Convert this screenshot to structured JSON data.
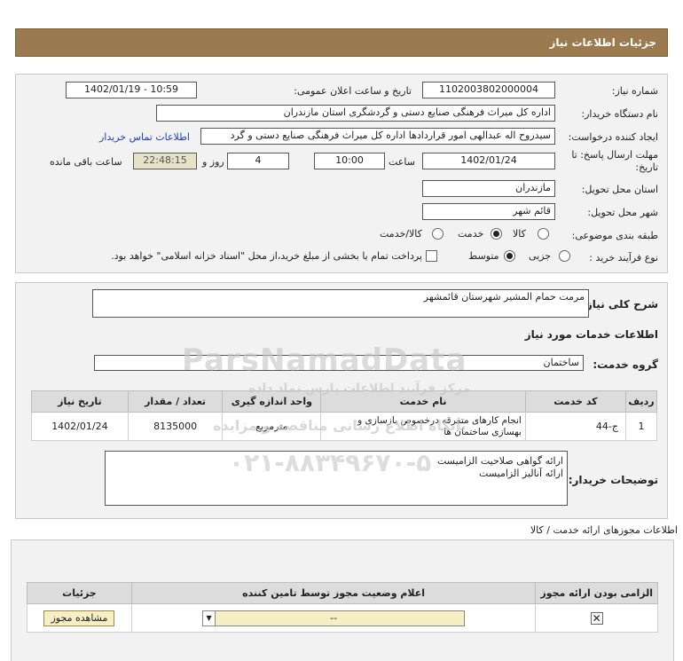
{
  "header": {
    "title": "جزئیات اطلاعات نیاز"
  },
  "labels": {
    "need_number": "شماره نیاز:",
    "announce_datetime": "تاریخ و ساعت اعلان عمومی:",
    "buyer_org": "نام دستگاه خریدار:",
    "requester": "ایجاد کننده درخواست:",
    "contact_link": "اطلاعات تماس خریدار",
    "deadline": "مهلت ارسال پاسخ: تا تاریخ:",
    "hour": "ساعت",
    "days_and": "روز و",
    "remaining": "ساعت باقی مانده",
    "delivery_province": "استان محل تحویل:",
    "delivery_city": "شهر محل تحویل:",
    "category": "طبقه بندی موضوعی:",
    "purchase_type": "نوع فرآیند خرید :",
    "description_title": "شرح کلی نیاز:",
    "services_info": "اطلاعات خدمات مورد نیاز",
    "service_group": "گروه خدمت:",
    "buyer_notes": "توضیحات خریدار:",
    "permits_title": "اطلاعات مجوزهای ارائه خدمت / کالا"
  },
  "fields": {
    "need_number": "1102003802000004",
    "announce_datetime": "1402/01/19 - 10:59",
    "buyer_org": "اداره کل میراث فرهنگی  صنایع دستی و گردشگری استان مازندران",
    "requester": "سیدروح اله عبدالهی امور قراردادها اداره کل میراث فرهنگی  صنایع دستی و گرد",
    "deadline_date": "1402/01/24",
    "deadline_time": "10:00",
    "days": "4",
    "remaining_time": "22:48:15",
    "province": "مازندران",
    "city": "قائم شهر",
    "description": "مرمت حمام المشیر شهرستان قائمشهر",
    "service_group": "ساختمان",
    "notes_line1": "ارائه گواهی صلاحیت الزامیست",
    "notes_line2": "ارائه آنالیز الزامیست"
  },
  "category_options": [
    {
      "label": "کالا",
      "selected": false
    },
    {
      "label": "خدمت",
      "selected": true
    },
    {
      "label": "کالا/خدمت",
      "selected": false
    }
  ],
  "purchase_options": [
    {
      "label": "جزیی",
      "selected": false
    },
    {
      "label": "متوسط",
      "selected": true
    }
  ],
  "payment_note": "پرداخت تمام یا بخشی از مبلغ خرید،از محل \"اسناد خزانه اسلامی\" خواهد بود.",
  "services_table": {
    "headers": [
      "ردیف",
      "کد خدمت",
      "نام خدمت",
      "واحد اندازه گیری",
      "تعداد / مقدار",
      "تاریخ نیاز"
    ],
    "rows": [
      [
        "1",
        "ج-44",
        "انجام کارهای متفرقه درخصوص بازسازی و بهسازی ساختمان ها",
        "مترمربع",
        "8135000",
        "1402/01/24"
      ]
    ]
  },
  "permits_table": {
    "headers": [
      "الزامی بودن ارائه مجوز",
      "اعلام وضعیت مجوز توسط تامین کننده",
      "جزئیات"
    ],
    "select_value": "--",
    "view_button": "مشاهده مجوز"
  },
  "watermark": {
    "text_en": "ParsNamadData",
    "text_fa1": "مرکز فرآیند اطلاعات پارس نماد داده",
    "text_fa2": "پایگاه اطلاع رسانی مناقصه و مزایده",
    "phone": "۰۲۱-۸۸۳۴۹۶۷۰-۵"
  }
}
